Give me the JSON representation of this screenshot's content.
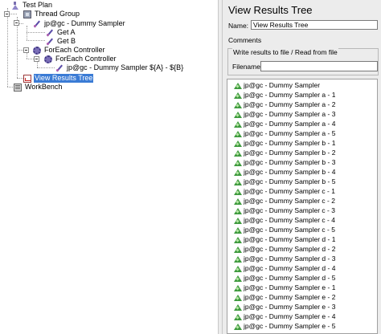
{
  "tree": {
    "nodes": [
      {
        "label": "Test Plan",
        "icon": "flask-icon"
      },
      {
        "label": "Thread Group",
        "icon": "thread-group-icon"
      },
      {
        "label": "jp@gc - Dummy Sampler",
        "icon": "sampler-icon"
      },
      {
        "label": "Get A",
        "icon": "sampler-icon"
      },
      {
        "label": "Get B",
        "icon": "sampler-icon"
      },
      {
        "label": "ForEach Controller",
        "icon": "gear-icon"
      },
      {
        "label": "ForEach Controller",
        "icon": "gear-icon"
      },
      {
        "label": "jp@gc - Dummy Sampler ${A} - ${B}",
        "icon": "sampler-icon"
      },
      {
        "label": "View Results Tree",
        "icon": "listener-icon",
        "selected": true
      },
      {
        "label": "WorkBench",
        "icon": "workbench-icon"
      }
    ]
  },
  "panel": {
    "title": "View Results Tree",
    "name_label": "Name:",
    "name_value": "View Results Tree",
    "comments_label": "Comments:",
    "file_section_label": "Write results to file / Read from file",
    "filename_label": "Filename",
    "filename_value": ""
  },
  "results": {
    "items": [
      "jp@gc - Dummy Sampler",
      "jp@gc - Dummy Sampler a - 1",
      "jp@gc - Dummy Sampler a - 2",
      "jp@gc - Dummy Sampler a - 3",
      "jp@gc - Dummy Sampler a - 4",
      "jp@gc - Dummy Sampler a - 5",
      "jp@gc - Dummy Sampler b - 1",
      "jp@gc - Dummy Sampler b - 2",
      "jp@gc - Dummy Sampler b - 3",
      "jp@gc - Dummy Sampler b - 4",
      "jp@gc - Dummy Sampler b - 5",
      "jp@gc - Dummy Sampler c - 1",
      "jp@gc - Dummy Sampler c - 2",
      "jp@gc - Dummy Sampler c - 3",
      "jp@gc - Dummy Sampler c - 4",
      "jp@gc - Dummy Sampler c - 5",
      "jp@gc - Dummy Sampler d - 1",
      "jp@gc - Dummy Sampler d - 2",
      "jp@gc - Dummy Sampler d - 3",
      "jp@gc - Dummy Sampler d - 4",
      "jp@gc - Dummy Sampler d - 5",
      "jp@gc - Dummy Sampler e - 1",
      "jp@gc - Dummy Sampler e - 2",
      "jp@gc - Dummy Sampler e - 3",
      "jp@gc - Dummy Sampler e - 4",
      "jp@gc - Dummy Sampler e - 5"
    ],
    "item_icon": "success-triangle-icon"
  },
  "colors": {
    "selection": "#3a7bd5",
    "panel_bg": "#ececec",
    "success": "#3e9a3e"
  }
}
